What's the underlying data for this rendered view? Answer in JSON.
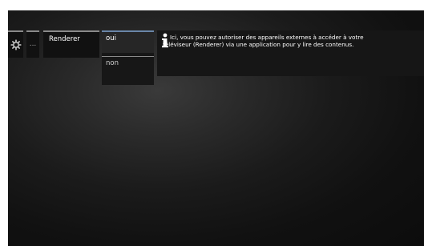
{
  "menu": {
    "settings_icon": "gear-icon",
    "more_label": "...",
    "renderer_label": "Renderer"
  },
  "options": {
    "selected": "oui",
    "other": "non"
  },
  "info": {
    "icon": "info-icon",
    "text": "Ici, vous pouvez autoriser des appareils externes à accéder à votre téléviseur (Renderer) via une application pour y lire des contenus."
  },
  "colors": {
    "background": "#1b1b1b",
    "panel": "#111111",
    "selected_bar": "#6a86a8"
  }
}
